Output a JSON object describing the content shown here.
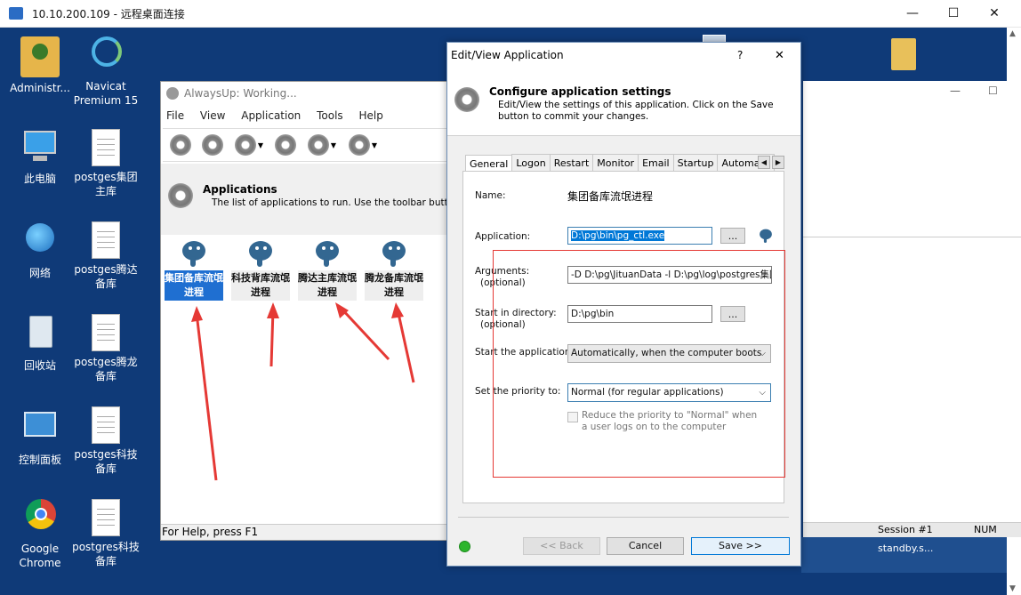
{
  "rdp": {
    "title": "10.10.200.109 - 远程桌面连接",
    "min": "—",
    "max": "☐",
    "close": "✕"
  },
  "desktop_icons": [
    {
      "label": "Administr..."
    },
    {
      "label": "Navicat Premium 15"
    },
    {
      "label": "此电脑"
    },
    {
      "label": "postges集团主库"
    },
    {
      "label": "网络"
    },
    {
      "label": "postges腾达备库"
    },
    {
      "label": "回收站"
    },
    {
      "label": "postges腾龙备库"
    },
    {
      "label": "控制面板"
    },
    {
      "label": "postges科技备库"
    },
    {
      "label": "Google Chrome"
    },
    {
      "label": "postgres科技备库"
    }
  ],
  "alwaysup": {
    "title": "AlwaysUp: Working...",
    "menu": [
      "File",
      "View",
      "Application",
      "Tools",
      "Help"
    ],
    "header_title": "Applications",
    "header_desc": "The list of applications to run. Use the toolbar buttons",
    "apps": [
      {
        "label": "集团备库流氓进程"
      },
      {
        "label": "科技背库流氓进程"
      },
      {
        "label": "腾达主库流氓进程"
      },
      {
        "label": "腾龙备库流氓进程"
      }
    ],
    "status_help": "For Help, press F1"
  },
  "bgwin": {
    "session": "Session #1",
    "num": "NUM",
    "standby": "standby.s...",
    "min": "—",
    "max": "☐"
  },
  "dialog": {
    "title": "Edit/View Application",
    "help": "?",
    "close": "✕",
    "header_title": "Configure application settings",
    "header_desc": "Edit/View the settings of this application. Click on the Save button to commit your changes.",
    "tabs": [
      "General",
      "Logon",
      "Restart",
      "Monitor",
      "Email",
      "Startup",
      "Automate"
    ],
    "name_label": "Name:",
    "name_value": "集团备库流氓进程",
    "application_label": "Application:",
    "application_value": "D:\\pg\\bin\\pg_ctl.exe",
    "browse": "...",
    "arguments_label": "Arguments:",
    "arguments_optional": "(optional)",
    "arguments_value": "-D D:\\pg\\JituanData -l D:\\pg\\log\\postgres集团",
    "startdir_label": "Start in directory:",
    "startdir_optional": "(optional)",
    "startdir_value": "D:\\pg\\bin",
    "start_app_label": "Start the application:",
    "start_app_value": "Automatically, when the computer boots",
    "priority_label": "Set the priority to:",
    "priority_value": "Normal (for regular applications)",
    "reduce_label": "Reduce the priority to \"Normal\" when a user logs on to the computer",
    "back": "<< Back",
    "cancel": "Cancel",
    "save": "Save >>"
  },
  "colors": {
    "desktop": "#0f3a78",
    "selection": "#1f6fd1",
    "annotation": "#e53935",
    "status_ok": "#2db52d"
  }
}
